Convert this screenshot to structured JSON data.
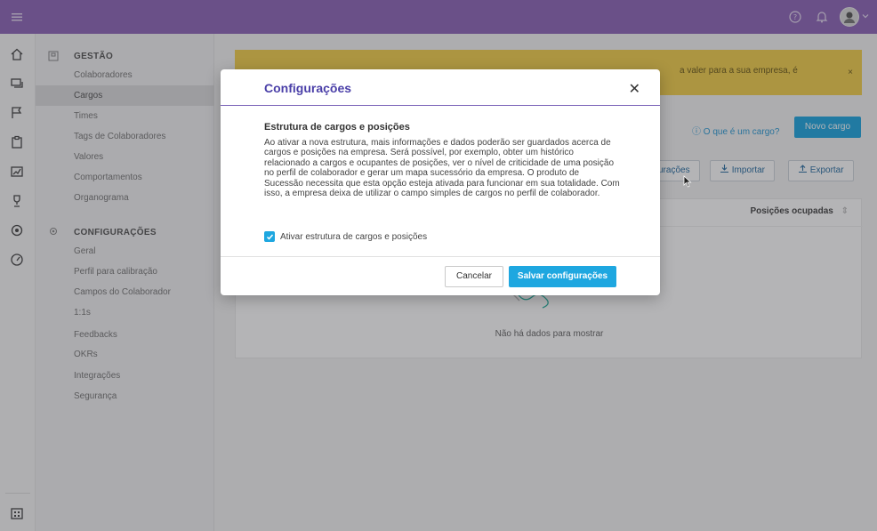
{
  "topbar": {
    "icons": [
      "menu-icon",
      "help-icon",
      "bell-icon",
      "avatar",
      "chevron-down-icon"
    ]
  },
  "rail": {
    "icons": [
      "home-icon",
      "chat-icon",
      "flag-icon",
      "clipboard-icon",
      "chart-icon",
      "trophy-icon",
      "target-icon",
      "speedometer-icon",
      "building-icon"
    ]
  },
  "submenu": {
    "gestao_title": "GESTÃO",
    "gestao_items": [
      {
        "label": "Colaboradores"
      },
      {
        "label": "Cargos"
      },
      {
        "label": "Times"
      },
      {
        "label": "Tags de Colaboradores"
      },
      {
        "label": "Valores"
      },
      {
        "label": "Comportamentos"
      },
      {
        "label": "Organograma"
      }
    ],
    "config_title": "CONFIGURAÇÕES",
    "config_items": [
      {
        "label": "Geral"
      },
      {
        "label": "Perfil para calibração"
      },
      {
        "label": "Campos do Colaborador"
      },
      {
        "label": "1:1s"
      },
      {
        "label": "Feedbacks"
      },
      {
        "label": "OKRs"
      },
      {
        "label": "Integrações"
      },
      {
        "label": "Segurança"
      }
    ]
  },
  "main": {
    "banner_text": "a valer para a sua empresa, é",
    "banner_close": "×",
    "what_is_link": "ⓘ O que é um cargo?",
    "new_button": "Novo cargo",
    "config_button_partial": "urações",
    "import_button": "Importar",
    "export_button": "Exportar",
    "column_positions": "Posições ocupadas",
    "empty_text": "Não há dados para mostrar"
  },
  "modal": {
    "title": "Configurações",
    "close": "✕",
    "subtitle": "Estrutura de cargos e posições",
    "description": "Ao ativar a nova estrutura, mais informações e dados poderão ser guardados acerca de cargos e posições na empresa. Será possível, por exemplo, obter um histórico relacionado a cargos e ocupantes de posições, ver o nível de criticidade de uma posição no perfil de colaborador e gerar um mapa sucessório da empresa. O produto de Sucessão necessita que esta opção esteja ativada para funcionar em sua totalidade. Com isso, a empresa deixa de utilizar o campo simples de cargos no perfil de colaborador.",
    "checkbox_label": "Ativar estrutura de cargos e posições",
    "checkbox_checked": true,
    "cancel_button": "Cancelar",
    "save_button": "Salvar configurações"
  },
  "colors": {
    "topbar": "#8e66b8",
    "accent": "#1ea7e0",
    "banner": "#f3cf4c",
    "modal_title": "#4a3fa8"
  }
}
